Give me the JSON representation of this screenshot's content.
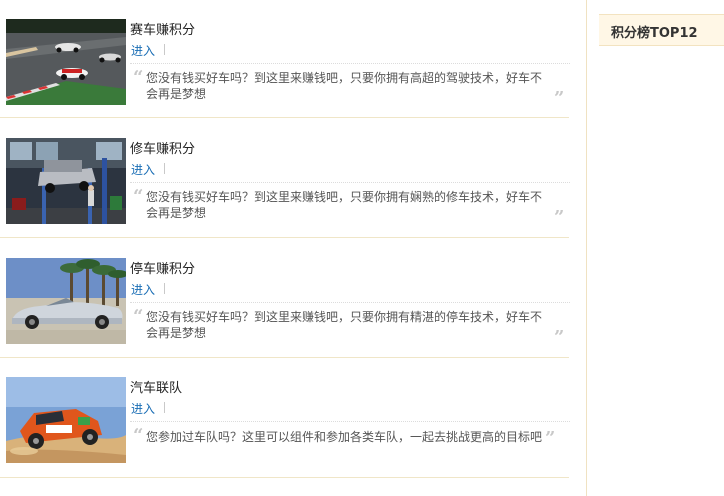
{
  "items": [
    {
      "title": "赛车赚积分",
      "enter_label": "进入",
      "description": "您没有钱买好车吗？到这里来赚钱吧，只要你拥有高超的驾驶技术，好车不会再是梦想",
      "thumbnail": "racing-cars-on-track"
    },
    {
      "title": "修车赚积分",
      "enter_label": "进入",
      "description": "您没有钱买好车吗？到这里来赚钱吧，只要你拥有娴熟的修车技术，好车不会再是梦想",
      "thumbnail": "repair-garage-lifted-car"
    },
    {
      "title": "停车赚积分",
      "enter_label": "进入",
      "description": "您没有钱买好车吗？到这里来赚钱吧，只要你拥有精湛的停车技术，好车不会再是梦想",
      "thumbnail": "silver-convertible-with-palms"
    },
    {
      "title": "汽车联队",
      "enter_label": "进入",
      "description": "您参加过车队吗？这里可以组件和参加各类车队，一起去挑战更高的目标吧",
      "thumbnail": "rally-car-on-sand"
    }
  ],
  "quote_open": "“",
  "quote_close": "”",
  "sidebar": {
    "title": "积分榜TOP12"
  },
  "colors": {
    "link": "#1a6eb5",
    "divider": "#f0e6c8",
    "sidebar_bg": "#fff7e6"
  }
}
